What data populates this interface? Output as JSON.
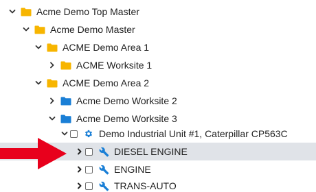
{
  "colors": {
    "folder_yellow": "#f7b500",
    "folder_blue": "#1a7fd6",
    "tool_blue": "#1a7fd6",
    "selection_bg": "#e0e3e8",
    "arrow_red": "#e8001c"
  },
  "tree": {
    "nodes": [
      {
        "label": "Acme Demo Top Master",
        "icon": "folder-icon",
        "expanded": true
      },
      {
        "label": "Acme Demo Master",
        "icon": "folder-icon",
        "expanded": true
      },
      {
        "label": "ACME Demo Area 1",
        "icon": "folder-icon",
        "expanded": true
      },
      {
        "label": "ACME Worksite 1",
        "icon": "folder-icon",
        "expanded": false
      },
      {
        "label": "ACME Demo Area 2",
        "icon": "folder-icon",
        "expanded": true
      },
      {
        "label": "Acme Demo Worksite 2",
        "icon": "folder-icon",
        "expanded": false
      },
      {
        "label": "Acme Demo Worksite 3",
        "icon": "folder-icon",
        "expanded": true
      },
      {
        "label": "Demo Industrial Unit #1, Caterpillar CP563C",
        "icon": "gear-icon",
        "expanded": true,
        "checked": false
      },
      {
        "label": "DIESEL ENGINE",
        "icon": "wrench-icon",
        "expanded": false,
        "checked": false,
        "selected": true
      },
      {
        "label": "ENGINE",
        "icon": "wrench-icon",
        "expanded": false,
        "checked": false
      },
      {
        "label": "TRANS-AUTO",
        "icon": "wrench-icon",
        "expanded": false,
        "checked": false
      }
    ]
  },
  "annotation": {
    "icon": "arrow-right-icon"
  }
}
